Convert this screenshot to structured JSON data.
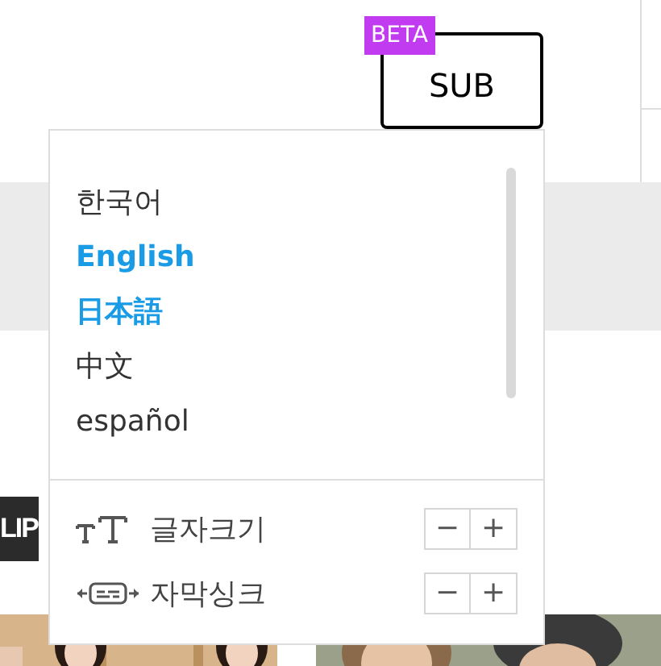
{
  "sub_button": {
    "label": "SUB",
    "badge": "BETA"
  },
  "clip_badge": "LIP",
  "language_menu": {
    "languages": [
      {
        "label": "한국어",
        "selected": false
      },
      {
        "label": "English",
        "selected": true
      },
      {
        "label": "日本語",
        "selected": true
      },
      {
        "label": "中文",
        "selected": false
      },
      {
        "label": "español",
        "selected": false
      }
    ],
    "settings": [
      {
        "kind": "font_size",
        "label": "글자크기",
        "buttons": [
          "−",
          "+"
        ]
      },
      {
        "kind": "subtitle_sync",
        "label": "자막싱크",
        "buttons": [
          "−",
          "+"
        ]
      }
    ]
  }
}
